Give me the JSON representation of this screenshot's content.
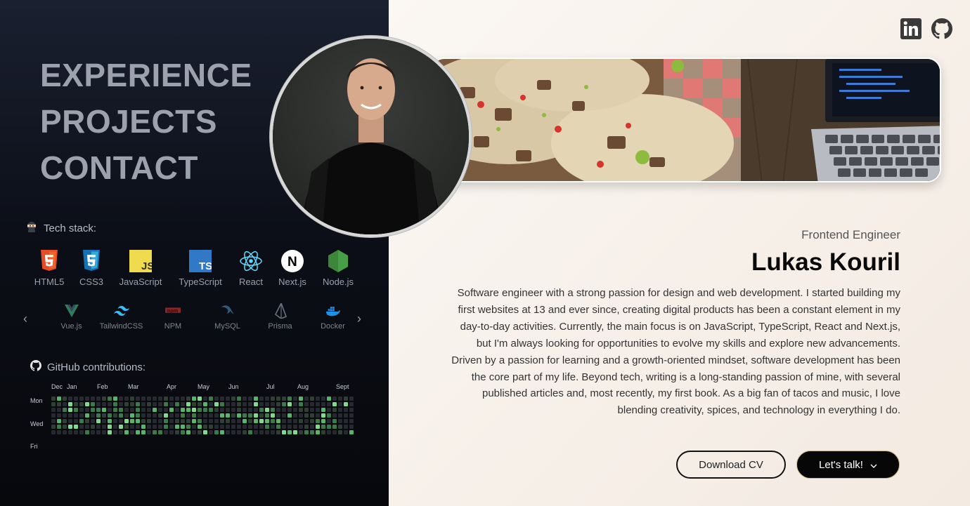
{
  "nav": [
    "EXPERIENCE",
    "PROJECTS",
    "CONTACT"
  ],
  "tech_stack": {
    "title": "Tech stack:",
    "row1": [
      {
        "label": "HTML5",
        "icon": "html5-icon"
      },
      {
        "label": "CSS3",
        "icon": "css3-icon"
      },
      {
        "label": "JavaScript",
        "icon": "javascript-icon"
      },
      {
        "label": "TypeScript",
        "icon": "typescript-icon"
      },
      {
        "label": "React",
        "icon": "react-icon"
      },
      {
        "label": "Next.js",
        "icon": "nextjs-icon"
      },
      {
        "label": "Node.js",
        "icon": "nodejs-icon"
      }
    ],
    "row2": [
      {
        "label": "Vue.js",
        "icon": "vue-icon"
      },
      {
        "label": "TailwindCSS",
        "icon": "tailwind-icon"
      },
      {
        "label": "NPM",
        "icon": "npm-icon"
      },
      {
        "label": "MySQL",
        "icon": "mysql-icon"
      },
      {
        "label": "Prisma",
        "icon": "prisma-icon"
      },
      {
        "label": "Docker",
        "icon": "docker-icon"
      }
    ]
  },
  "github": {
    "title": "GitHub contributions:",
    "months": [
      "Dec",
      "Jan",
      "Feb",
      "Mar",
      "Apr",
      "May",
      "Jun",
      "Jul",
      "Aug",
      "Sept"
    ],
    "days": [
      "Mon",
      "Wed",
      "Fri"
    ]
  },
  "profile": {
    "role": "Frontend Engineer",
    "name": "Lukas Kouril",
    "bio": "Software engineer with a strong passion for design and web development. I started building my first websites at 13 and ever since, creating digital products has been a constant element in my day-to-day activities. Currently, the main focus is on JavaScript, TypeScript, React and Next.js, but I'm always looking for opportunities to evolve my skills and explore new advancements. Driven by a passion for learning and a growth-oriented mindset, software development has been the core part of my life. Beyond tech, writing is a long-standing passion of mine, with several published articles and, most recently, my first book. As a big fan of tacos and music, I love blending creativity, spices, and technology in everything I do."
  },
  "buttons": {
    "cv": "Download CV",
    "talk": "Let's talk!"
  },
  "colors": {
    "accent_green": "#4fb065",
    "dark": "#07080c",
    "cream": "#f6f0ea"
  }
}
